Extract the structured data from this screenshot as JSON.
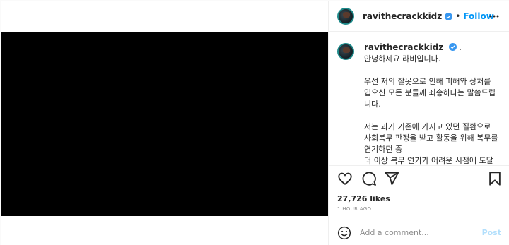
{
  "post": {
    "username": "ravithecrackkidz",
    "follow_label": "Follow",
    "header_separator": "•",
    "caption_suffix": ".",
    "caption_lines": [
      "안녕하세요 라비입니다.",
      "",
      "우선 저의 잘못으로 인해 피해와 상처를 입으신 모든 분들께 죄송하다는 말씀드립니다.",
      "",
      "저는 과거 기존에 가지고 있던 질환으로 사회복무 판정을 받고 활동을 위해 복무를 연기하던 중",
      "더 이상 복무 연기가 어려운 시점에 도달하게 되었었습니다."
    ],
    "likes": "27,726 likes",
    "time": "1 HOUR AGO"
  },
  "comment": {
    "placeholder": "Add a comment...",
    "post_label": "Post"
  },
  "icons": {
    "like": "heart-icon",
    "comment": "comment-icon",
    "share": "share-icon",
    "save": "bookmark-icon",
    "more": "more-options-icon",
    "emoji": "emoji-icon",
    "verified": "verified-badge-icon"
  },
  "colors": {
    "link_blue": "#0095f6",
    "post_disabled": "#b2dffc",
    "verified_blue": "#3897f0",
    "media_bg": "#000000"
  }
}
